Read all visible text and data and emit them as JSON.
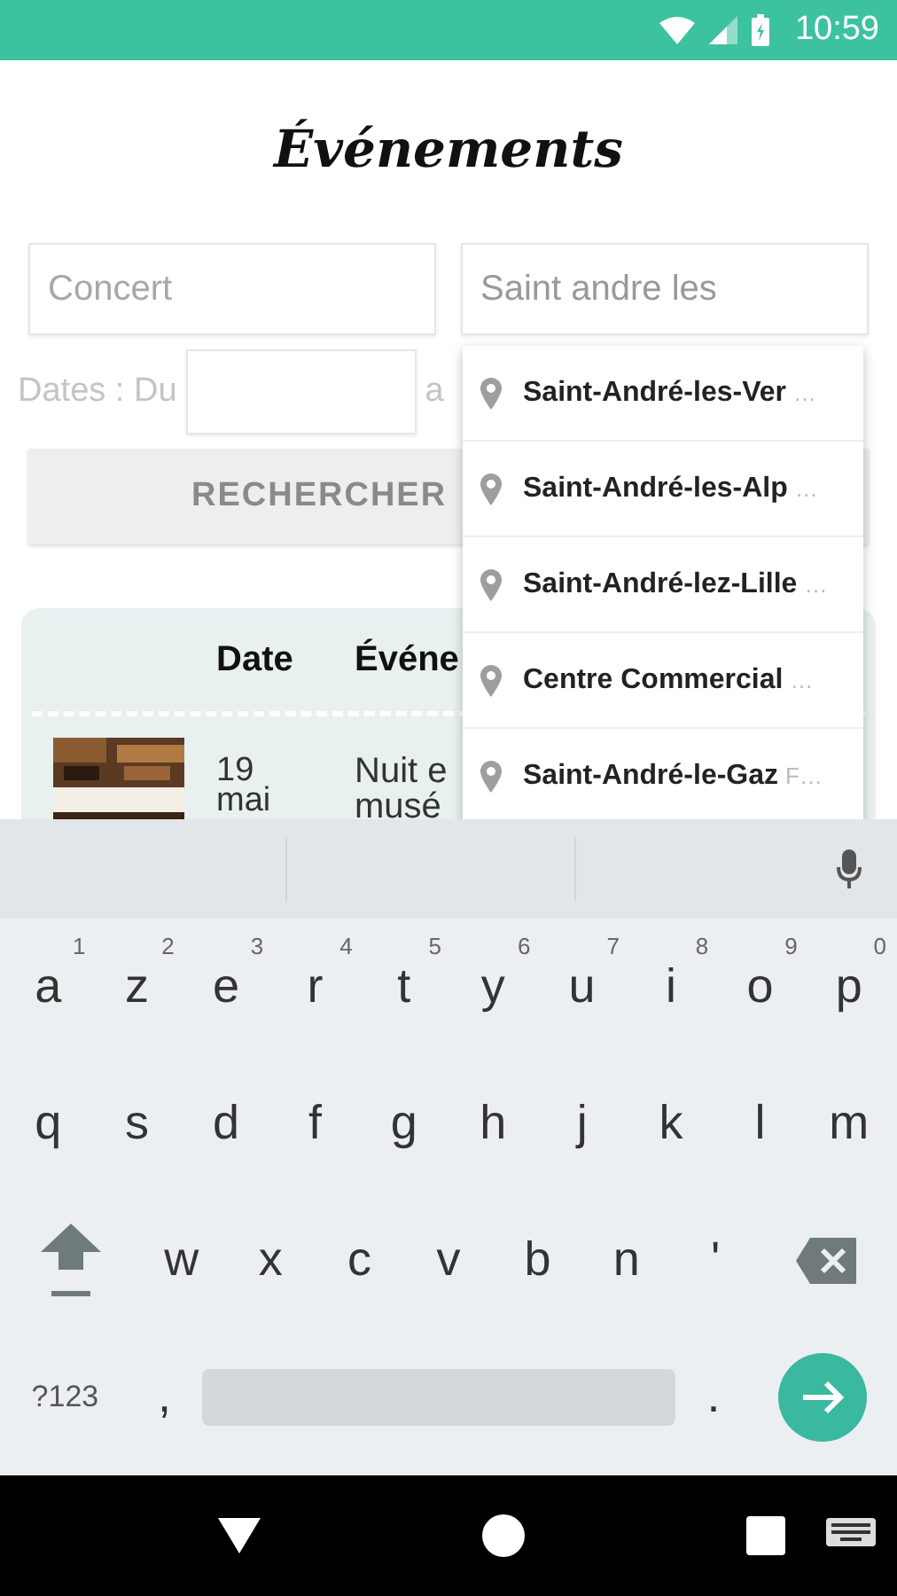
{
  "status_bar": {
    "time": "10:59"
  },
  "title": "Événements",
  "search": {
    "keyword": {
      "placeholder": "Concert"
    },
    "place": {
      "value": "Saint andre les"
    }
  },
  "dates": {
    "label": "Dates : Du",
    "to_label": "a"
  },
  "search_button": "RECHERCHER",
  "table": {
    "columns": [
      "Date",
      "Événe"
    ],
    "rows": [
      {
        "kind": "picture",
        "date_lines": [
          "19",
          "mai"
        ],
        "event_lines": [
          "Nuit e",
          "musé"
        ]
      }
    ]
  },
  "suggestions": [
    {
      "main": "Saint-André-les-Ver",
      "secondary": "…"
    },
    {
      "main": "Saint-André-les-Alp",
      "secondary": "…"
    },
    {
      "main": "Saint-André-lez-Lille",
      "secondary": "…"
    },
    {
      "main": "Centre Commercial",
      "secondary": "…"
    },
    {
      "main": "Saint-André-le-Gaz",
      "secondary": "F…"
    }
  ],
  "keyboard": {
    "rows": [
      [
        {
          "kind": "char",
          "label": "a",
          "hint": "1"
        },
        {
          "kind": "char",
          "label": "z",
          "hint": "2"
        },
        {
          "kind": "char",
          "label": "e",
          "hint": "3"
        },
        {
          "kind": "char",
          "label": "r",
          "hint": "4"
        },
        {
          "kind": "char",
          "label": "t",
          "hint": "5"
        },
        {
          "kind": "char",
          "label": "y",
          "hint": "6"
        },
        {
          "kind": "char",
          "label": "u",
          "hint": "7"
        },
        {
          "kind": "char",
          "label": "i",
          "hint": "8"
        },
        {
          "kind": "char",
          "label": "o",
          "hint": "9"
        },
        {
          "kind": "char",
          "label": "p",
          "hint": "0"
        }
      ],
      [
        {
          "kind": "char",
          "label": "q"
        },
        {
          "kind": "char",
          "label": "s"
        },
        {
          "kind": "char",
          "label": "d"
        },
        {
          "kind": "char",
          "label": "f"
        },
        {
          "kind": "char",
          "label": "g"
        },
        {
          "kind": "char",
          "label": "h"
        },
        {
          "kind": "char",
          "label": "j"
        },
        {
          "kind": "char",
          "label": "k"
        },
        {
          "kind": "char",
          "label": "l"
        },
        {
          "kind": "char",
          "label": "m"
        }
      ],
      [
        {
          "kind": "shift"
        },
        {
          "kind": "char",
          "label": "w"
        },
        {
          "kind": "char",
          "label": "x"
        },
        {
          "kind": "char",
          "label": "c"
        },
        {
          "kind": "char",
          "label": "v"
        },
        {
          "kind": "char",
          "label": "b"
        },
        {
          "kind": "char",
          "label": "n"
        },
        {
          "kind": "char",
          "label": "'"
        },
        {
          "kind": "backspace"
        }
      ],
      [
        {
          "kind": "symbols",
          "label": "?123"
        },
        {
          "kind": "char",
          "label": ","
        },
        {
          "kind": "space"
        },
        {
          "kind": "char",
          "label": "."
        },
        {
          "kind": "enter"
        }
      ]
    ]
  }
}
